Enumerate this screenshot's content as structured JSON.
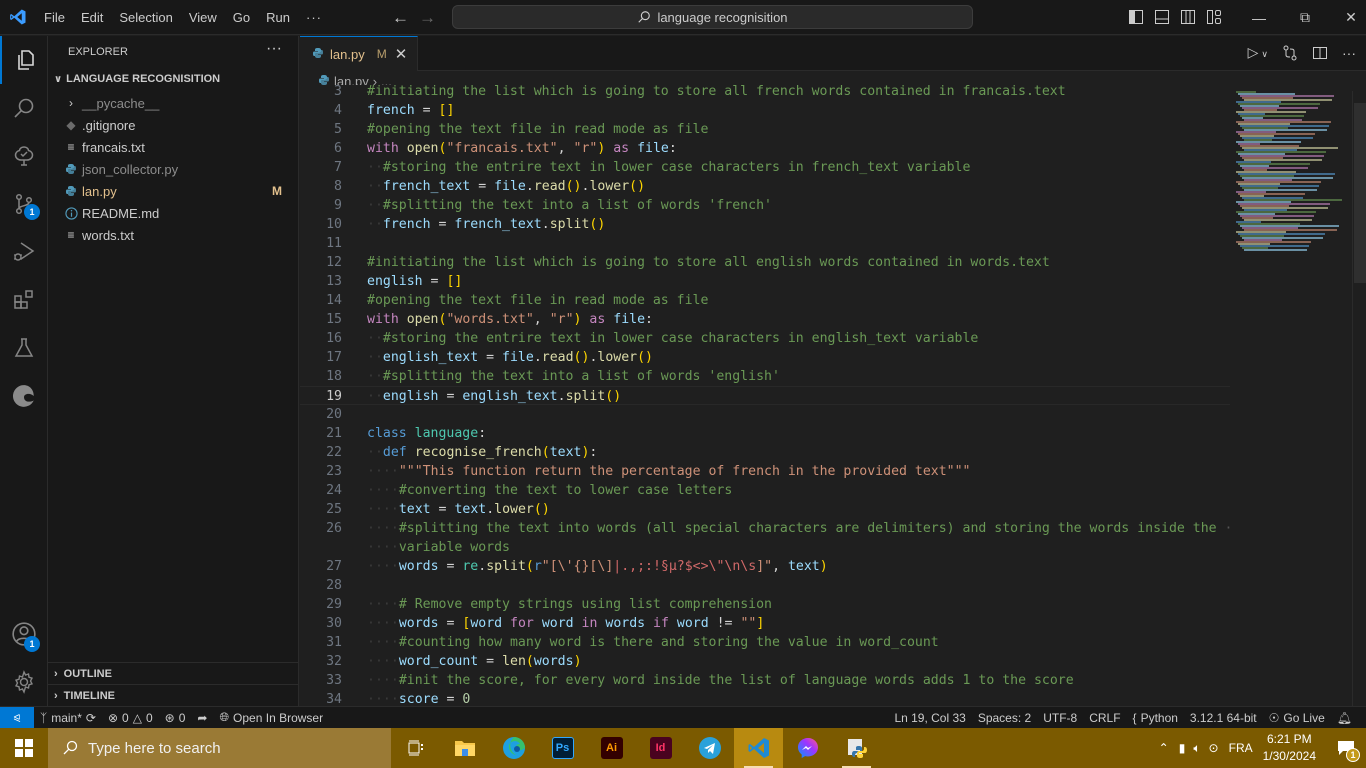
{
  "titlebar": {
    "menu": [
      "File",
      "Edit",
      "Selection",
      "View",
      "Go",
      "Run",
      "···"
    ],
    "search_text": "language recognisition",
    "window_controls": [
      "minimize-icon",
      "restore-icon",
      "close-icon"
    ]
  },
  "activity_bar": {
    "items": [
      {
        "icon": "explorer-icon",
        "active": true
      },
      {
        "icon": "search-icon"
      },
      {
        "icon": "tree-check-icon"
      },
      {
        "icon": "source-control-icon",
        "badge": "1"
      },
      {
        "icon": "run-debug-icon"
      },
      {
        "icon": "extensions-icon"
      },
      {
        "icon": "testing-icon"
      },
      {
        "icon": "edge-icon"
      }
    ],
    "bottom": [
      {
        "icon": "accounts-icon",
        "badge": "1"
      },
      {
        "icon": "gear-icon"
      }
    ]
  },
  "sidebar": {
    "title": "EXPLORER",
    "project": "LANGUAGE RECOGNISITION",
    "items": [
      {
        "label": "__pycache__",
        "icon": "chevron-right-icon",
        "dim": true
      },
      {
        "label": ".gitignore",
        "icon": "git-diamond-icon"
      },
      {
        "label": "francais.txt",
        "icon": "text-file-icon"
      },
      {
        "label": "json_collector.py",
        "icon": "python-icon",
        "dim": true
      },
      {
        "label": "lan.py",
        "icon": "python-icon",
        "git": "M"
      },
      {
        "label": "README.md",
        "icon": "info-icon"
      },
      {
        "label": "words.txt",
        "icon": "text-file-icon"
      }
    ],
    "panels": [
      "OUTLINE",
      "TIMELINE"
    ]
  },
  "editor": {
    "tab": {
      "label": "lan.py",
      "status": "M"
    },
    "breadcrumb": [
      "lan.py",
      "..."
    ],
    "cursor_line": 19,
    "lines": [
      {
        "n": "3",
        "text": "#initiating the list which is going to store all french words contained in francais.text"
      },
      {
        "n": "4",
        "text": "french = []"
      },
      {
        "n": "5",
        "text": "#opening the text file in read mode as file"
      },
      {
        "n": "6",
        "text": "with open(\"francais.txt\", \"r\") as file:"
      },
      {
        "n": "7",
        "text": "  #storing the entrire text in lower case characters in french_text variable"
      },
      {
        "n": "8",
        "text": "  french_text = file.read().lower()"
      },
      {
        "n": "9",
        "text": "  #splitting the text into a list of words 'french'"
      },
      {
        "n": "10",
        "text": "  french = french_text.split()"
      },
      {
        "n": "11",
        "text": ""
      },
      {
        "n": "12",
        "text": "#initiating the list which is going to store all english words contained in words.text"
      },
      {
        "n": "13",
        "text": "english = []"
      },
      {
        "n": "14",
        "text": "#opening the text file in read mode as file"
      },
      {
        "n": "15",
        "text": "with open(\"words.txt\", \"r\") as file:"
      },
      {
        "n": "16",
        "text": "  #storing the entrire text in lower case characters in english_text variable"
      },
      {
        "n": "17",
        "text": "  english_text = file.read().lower()"
      },
      {
        "n": "18",
        "text": "  #splitting the text into a list of words 'english'"
      },
      {
        "n": "19",
        "text": "  english = english_text.split()"
      },
      {
        "n": "20",
        "text": ""
      },
      {
        "n": "21",
        "text": "class language:"
      },
      {
        "n": "22",
        "text": "  def recognise_french(text):"
      },
      {
        "n": "23",
        "text": "    \"\"\"This function return the percentage of french in the provided text\"\"\""
      },
      {
        "n": "24",
        "text": "    #converting the text to lower case letters"
      },
      {
        "n": "25",
        "text": "    text = text.lower()"
      },
      {
        "n": "26",
        "text": "    #splitting the text into words (all special characters are delimiters) and storing the words inside the"
      },
      {
        "n": "",
        "text": "    variable words"
      },
      {
        "n": "27",
        "text": "    words = re.split(r\"[\\'{}[\\]|.,;:!§µ?$<>\\\"\\n\\s]\", text)"
      },
      {
        "n": "28",
        "text": ""
      },
      {
        "n": "29",
        "text": "    # Remove empty strings using list comprehension"
      },
      {
        "n": "30",
        "text": "    words = [word for word in words if word != \"\"]"
      },
      {
        "n": "31",
        "text": "    #counting how many word is there and storing the value in word_count"
      },
      {
        "n": "32",
        "text": "    word_count = len(words)"
      },
      {
        "n": "33",
        "text": "    #init the score, for every word inside the list of language words adds 1 to the score"
      },
      {
        "n": "34",
        "text": "    score = 0"
      }
    ]
  },
  "statusbar": {
    "branch": "main*",
    "errors": "0",
    "warnings": "0",
    "ports": "0",
    "open_in_browser": "Open In Browser",
    "position": "Ln 19, Col 33",
    "spaces": "Spaces: 2",
    "encoding": "UTF-8",
    "eol": "CRLF",
    "language": "Python",
    "interpreter": "3.12.1 64-bit",
    "go_live": "Go Live"
  },
  "taskbar": {
    "search_placeholder": "Type here to search",
    "apps": [
      "task-view-icon",
      "file-explorer-icon",
      "edge-icon",
      "photoshop-icon",
      "illustrator-icon",
      "indesign-icon",
      "telegram-icon",
      "vscode-icon",
      "messenger-icon",
      "python-idle-icon"
    ],
    "language": "FRA",
    "time": "6:21 PM",
    "date": "1/30/2024",
    "notifications": "1"
  },
  "colors": {
    "accent": "#0078d4",
    "modified": "#e2c08d",
    "taskbar": "#7b5a00"
  }
}
